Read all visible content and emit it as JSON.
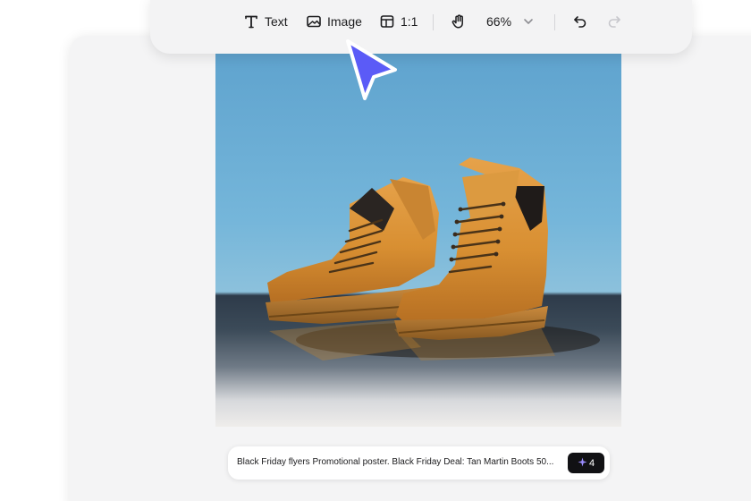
{
  "toolbar": {
    "text_label": "Text",
    "image_label": "Image",
    "ratio_label": "1:1",
    "zoom_label": "66%",
    "icons": [
      "text-icon",
      "image-icon",
      "layout-icon",
      "hand-icon",
      "chevron-down-icon",
      "undo-icon",
      "redo-icon"
    ]
  },
  "canvas": {
    "image_subject": "tan lace-up work boots pair"
  },
  "prompt": {
    "text": "Black Friday flyers Promotional poster. Black Friday Deal: Tan Martin Boots 50...",
    "generate_count": "4",
    "generate_icon": "sparkle-icon"
  },
  "colors": {
    "accent_cursor": "#5b5bf7",
    "generate_button": "#111114",
    "canvas_bg": "#f4f4f5"
  }
}
